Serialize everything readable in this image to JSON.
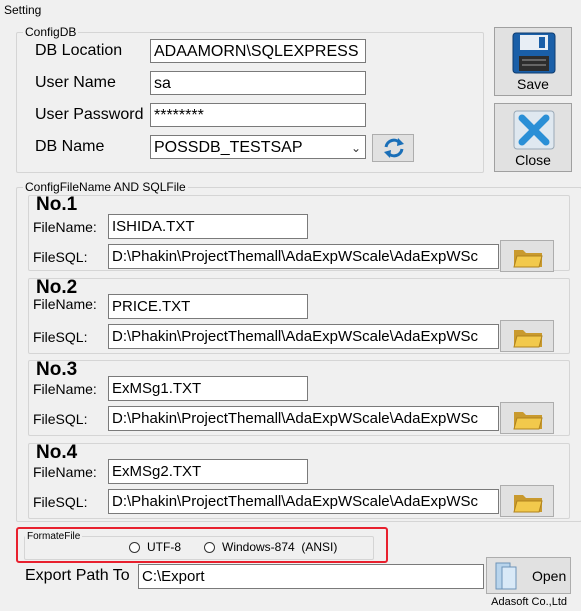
{
  "window": {
    "title": "Setting"
  },
  "config_db": {
    "legend": "ConfigDB",
    "db_location_label": "DB Location",
    "db_location_value": "ADAAMORN\\SQLEXPRESS",
    "user_name_label": "User Name",
    "user_name_value": "sa",
    "user_password_label": "User Password",
    "user_password_value": "********",
    "db_name_label": "DB Name",
    "db_name_value": "POSSDB_TESTSAP"
  },
  "buttons": {
    "save_label": "Save",
    "close_label": "Close",
    "open_label": "Open"
  },
  "config_files": {
    "legend": "ConfigFileName AND SQLFile",
    "filename_label": "FileName:",
    "filesql_label": "FileSQL:",
    "items": [
      {
        "title": "No.1",
        "filename": "ISHIDA.TXT",
        "filesql": "D:\\Phakin\\ProjectThemall\\AdaExpWScale\\AdaExpWSc"
      },
      {
        "title": "No.2",
        "filename": "PRICE.TXT",
        "filesql": "D:\\Phakin\\ProjectThemall\\AdaExpWScale\\AdaExpWSc"
      },
      {
        "title": "No.3",
        "filename": "ExMSg1.TXT",
        "filesql": "D:\\Phakin\\ProjectThemall\\AdaExpWScale\\AdaExpWSc"
      },
      {
        "title": "No.4",
        "filename": "ExMSg2.TXT",
        "filesql": "D:\\Phakin\\ProjectThemall\\AdaExpWScale\\AdaExpWSc"
      }
    ]
  },
  "format_file": {
    "legend": "FormateFile",
    "options": [
      {
        "label": "UTF-8",
        "selected": false
      },
      {
        "label": "Windows-874  (ANSI)",
        "selected": false
      }
    ]
  },
  "export": {
    "label": "Export Path To",
    "value": "C:\\Export"
  },
  "footer": {
    "company": "Adasoft Co.,Ltd"
  },
  "colors": {
    "highlight_box": "#e8202e",
    "save_icon": "#1a5fa8",
    "close_icon": "#2a8fd6"
  }
}
